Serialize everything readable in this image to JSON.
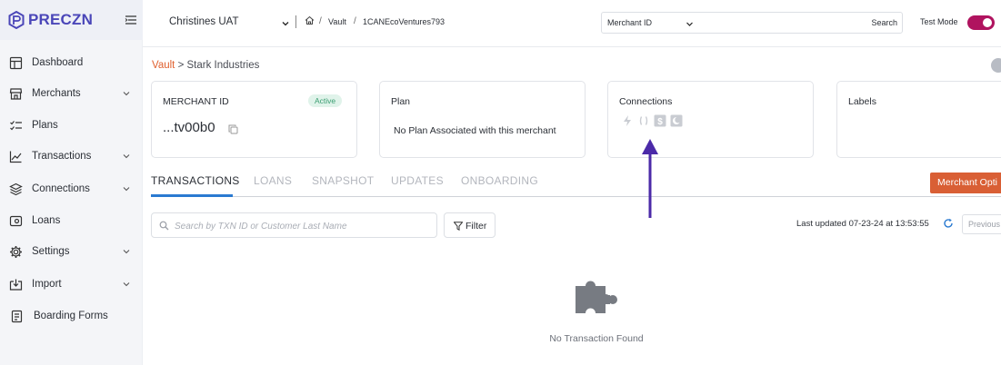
{
  "app": {
    "logo_text": "PRECZN"
  },
  "sidebar": {
    "items": [
      {
        "label": "Dashboard",
        "icon": "dashboard-icon",
        "has_children": false
      },
      {
        "label": "Merchants",
        "icon": "store-icon",
        "has_children": true
      },
      {
        "label": "Plans",
        "icon": "checklist-icon",
        "has_children": false
      },
      {
        "label": "Transactions",
        "icon": "chart-line-icon",
        "has_children": true
      },
      {
        "label": "Connections",
        "icon": "layers-icon",
        "has_children": true
      },
      {
        "label": "Loans",
        "icon": "money-icon",
        "has_children": false
      },
      {
        "label": "Settings",
        "icon": "gear-icon",
        "has_children": true
      },
      {
        "label": "Import",
        "icon": "import-icon",
        "has_children": true
      },
      {
        "label": "Boarding Forms",
        "icon": "form-icon",
        "has_children": false
      }
    ]
  },
  "header": {
    "org_name": "Christines UAT",
    "breadcrumb": [
      "Vault",
      "1CANEcoVentures793"
    ],
    "search_field": "Merchant ID",
    "search_button": "Search",
    "test_mode_label": "Test Mode",
    "test_mode_on": true
  },
  "page": {
    "breadcrumb_link": "Vault",
    "breadcrumb_separator": ">",
    "breadcrumb_current": "Stark Industries"
  },
  "cards": {
    "merchant": {
      "title": "MERCHANT ID",
      "status": "Active",
      "id_value": "...tv00b0"
    },
    "plan": {
      "title": "Plan",
      "text": "No Plan Associated with this merchant"
    },
    "connections": {
      "title": "Connections",
      "icons": [
        "bolt-icon",
        "bracket-icon",
        "dollar-icon",
        "moon-icon"
      ]
    },
    "labels": {
      "title": "Labels"
    }
  },
  "tabs": [
    "TRANSACTIONS",
    "LOANS",
    "SNAPSHOT",
    "UPDATES",
    "ONBOARDING"
  ],
  "active_tab": "TRANSACTIONS",
  "merchant_options_button": "Merchant Opti",
  "transactions": {
    "search_placeholder": "Search by TXN ID or Customer Last Name",
    "filter_label": "Filter",
    "last_updated": "Last updated 07-23-24 at 13:53:55",
    "previous_label": "Previous",
    "empty_text": "No Transaction Found"
  },
  "colors": {
    "brand": "#4a46b8",
    "accent_orange": "#d95f35",
    "toggle": "#b0135f",
    "tab_active_underline": "#2a7ad1",
    "annotation_arrow": "#4b2aa8"
  }
}
